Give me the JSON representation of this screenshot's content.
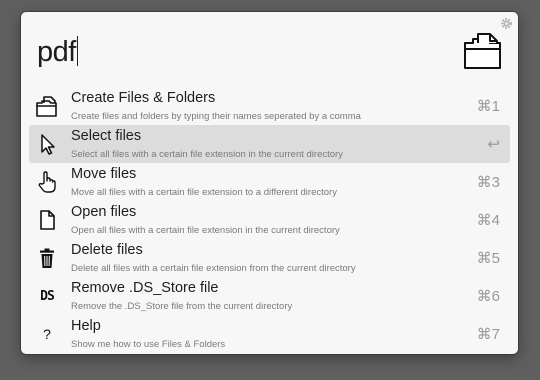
{
  "search": {
    "query": "pdf"
  },
  "results": [
    {
      "title": "Create Files & Folders",
      "subtitle": "Create files and folders by typing their names seperated by a comma",
      "shortcut": "⌘1",
      "icon": "folder-stack-icon"
    },
    {
      "title": "Select files",
      "subtitle": "Select all files with a certain file extension in the current directory",
      "shortcut": "↩",
      "icon": "cursor-arrow-icon",
      "selected": true
    },
    {
      "title": "Move files",
      "subtitle": "Move all files with a certain file extension to a different directory",
      "shortcut": "⌘3",
      "icon": "hand-pointer-icon"
    },
    {
      "title": "Open files",
      "subtitle": "Open all files with a certain file extension in the current directory",
      "shortcut": "⌘4",
      "icon": "document-icon"
    },
    {
      "title": "Delete files",
      "subtitle": "Delete all files with a certain file extension from the current directory",
      "shortcut": "⌘5",
      "icon": "trash-icon"
    },
    {
      "title": "Remove .DS_Store file",
      "subtitle": "Remove the .DS_Store file from the current directory",
      "shortcut": "⌘6",
      "icon": "ds-text-icon",
      "icon_text": "DS"
    },
    {
      "title": "Help",
      "subtitle": "Show me how to use Files & Folders",
      "shortcut": "⌘7",
      "icon": "question-mark-icon",
      "icon_text": "?"
    }
  ]
}
